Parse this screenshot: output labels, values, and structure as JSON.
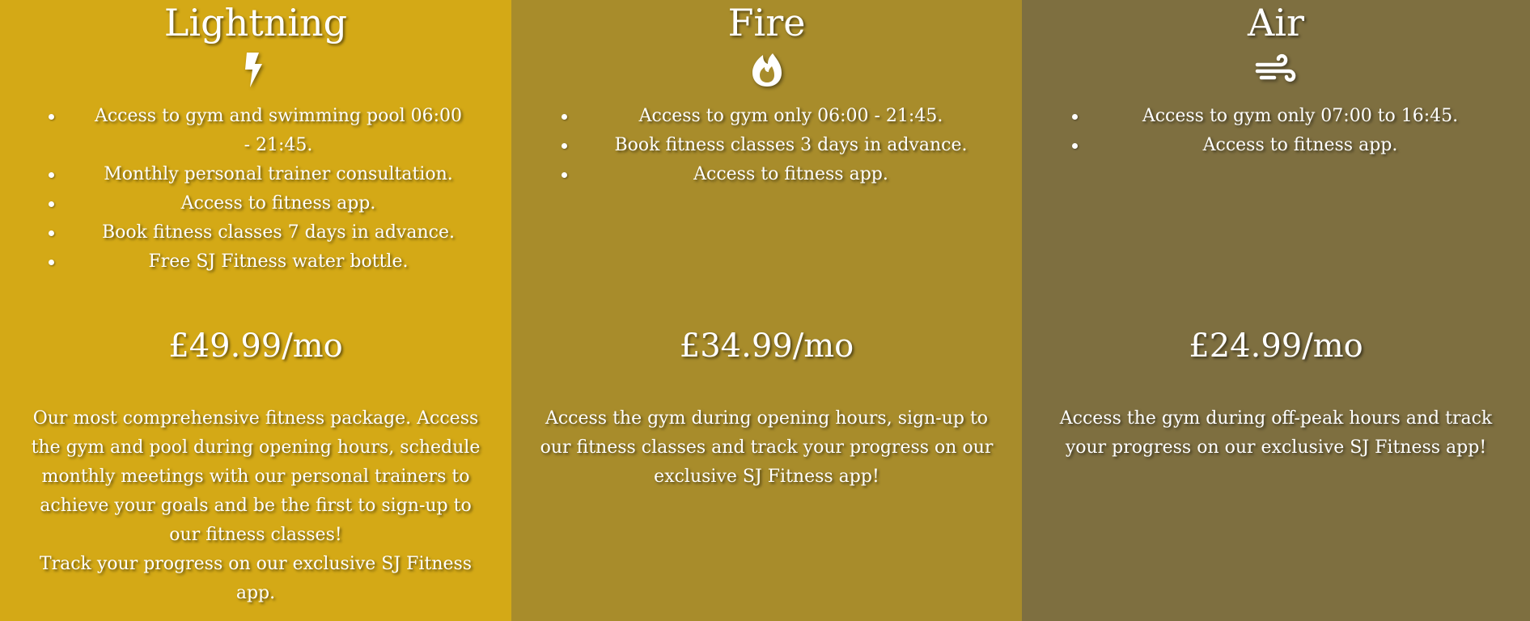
{
  "plans": [
    {
      "name": "Lightning",
      "icon": "lightning-bolt-icon",
      "features": [
        "Access to gym and swimming pool 06:00 - 21:45.",
        "Monthly personal trainer consultation.",
        "Access to fitness app.",
        "Book fitness classes 7 days in advance.",
        "Free SJ Fitness water bottle."
      ],
      "price": "£49.99/mo",
      "description": [
        "Our most comprehensive fitness package. Access the gym and pool during opening hours, schedule monthly meetings with our personal trainers to achieve your goals and be the first to sign-up to our fitness classes!",
        "Track your progress on our exclusive SJ Fitness app."
      ],
      "background": "#d4a916"
    },
    {
      "name": "Fire",
      "icon": "fire-icon",
      "features": [
        "Access to gym only 06:00 - 21:45.",
        "Book fitness classes 3 days in advance.",
        "Access to fitness app."
      ],
      "price": "£34.99/mo",
      "description": [
        "Access the gym during opening hours, sign-up to our fitness classes and track your progress on our exclusive SJ Fitness app!"
      ],
      "background": "#a88c2b"
    },
    {
      "name": "Air",
      "icon": "wind-icon",
      "features": [
        "Access to gym only 07:00 to 16:45.",
        "Access to fitness app."
      ],
      "price": "£24.99/mo",
      "description": [
        "Access the gym during off-peak hours and track your progress on our exclusive SJ Fitness app!"
      ],
      "background": "#7e6f40"
    }
  ]
}
